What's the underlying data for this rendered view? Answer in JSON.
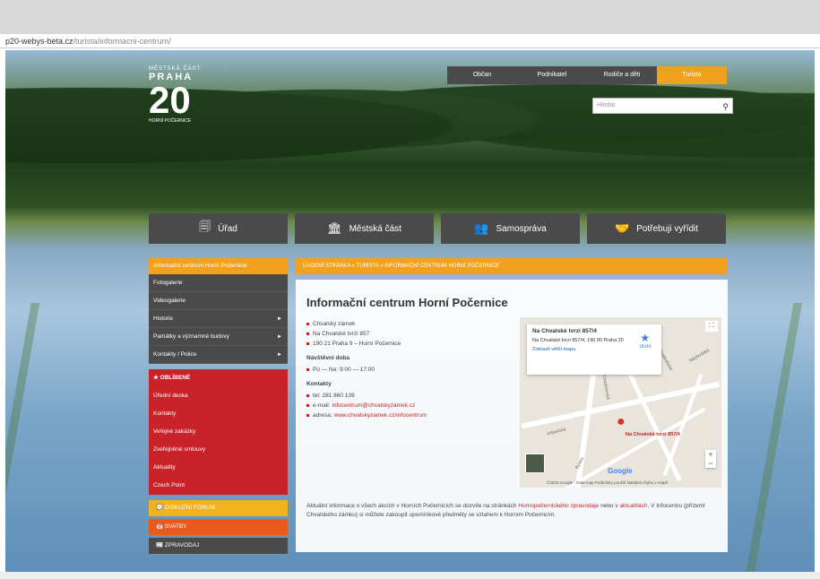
{
  "browser": {
    "url_host": "p20-webys-beta.cz",
    "url_path": "/turista/informacni-centrum/"
  },
  "logo": {
    "small": "MĚSTSKÁ ČÁST",
    "praha": "PRAHA",
    "number": "20",
    "sub": "HORNÍ POČERNICE"
  },
  "topnav": [
    "Občan",
    "Podnikatel",
    "Rodiče a děti",
    "Turista"
  ],
  "search": {
    "placeholder": "Hledat"
  },
  "mainnav": [
    {
      "label": "Úřad",
      "icon": "document-icon"
    },
    {
      "label": "Městská část",
      "icon": "building-icon"
    },
    {
      "label": "Samospráva",
      "icon": "people-icon"
    },
    {
      "label": "Potřebuji vyřídit",
      "icon": "handshake-icon"
    }
  ],
  "sidebar": {
    "active": "Informační centrum Horní Počernice",
    "items": [
      {
        "label": "Fotogalerie",
        "arrow": ""
      },
      {
        "label": "Videogalerie",
        "arrow": ""
      },
      {
        "label": "Historie",
        "arrow": "►"
      },
      {
        "label": "Památky a významné budovy",
        "arrow": "►"
      },
      {
        "label": "Kontakty / Police",
        "arrow": "►"
      }
    ],
    "favorites_header": "★ OBLÍBENÉ",
    "favorites": [
      "Úřední deska",
      "Kontakty",
      "Veřejné zakázky",
      "Zveřejněné smlouvy",
      "Aktuality",
      "Czech Point"
    ],
    "blocks": [
      "DISKUZNÍ FÓRUM",
      "SVATBY",
      "ZPRAVODAJ"
    ]
  },
  "breadcrumb": "ÚVODNÍ STRÁNKA  »  TURISTA  »  INFORMAČNÍ CENTRUM HORNÍ POČERNICE",
  "content": {
    "title": "Informační centrum Horní Počernice",
    "address": [
      "Chvalský zámek",
      "Na Chvalské tvrzi 857",
      "190 21 Praha 9 – Horní Počernice"
    ],
    "hours_title": "Návštěvní doba",
    "hours": [
      "Po — Ne: 9:00 — 17:00"
    ],
    "contacts_title": "Kontakty",
    "phone": "tel: 281 860 139",
    "email_prefix": "e-mail: ",
    "email": "infocentrum@chvalskyzamek.cz",
    "web_prefix": "adresa: ",
    "web": "www.chvalskyzamek.cz/infocentrum",
    "bottom_1": "Aktuální informace o všech akcích v Horních Počernicích se dozvíte na stránkách ",
    "bottom_link1": "Hornopočernického zpravodaje",
    "bottom_2": " nebo v ",
    "bottom_link2": "aktualitách",
    "bottom_3": ". V Infocentru (přízemí Chvalského zámku) si můžete zakoupit upomínkové předměty se vztahem k Horním Počernicím."
  },
  "map": {
    "popup_title": "Na Chvalské tvrzi 857/4",
    "popup_address": "Na Chvalské tvrzi 857/4, 190 00 Praha 20",
    "popup_link": "Zobrazit větší mapu",
    "save_label": "Uložit",
    "pin_label": "Na Chvalské tvrzi 857/4",
    "google": "Google",
    "footer": "©2015 Google · Data map   Podmínky použití   Nahlásit chybu v mapě",
    "streets": [
      "Vršovická",
      "Bystrá",
      "Chodovecká",
      "Ratibořická",
      "Náchodská"
    ]
  }
}
